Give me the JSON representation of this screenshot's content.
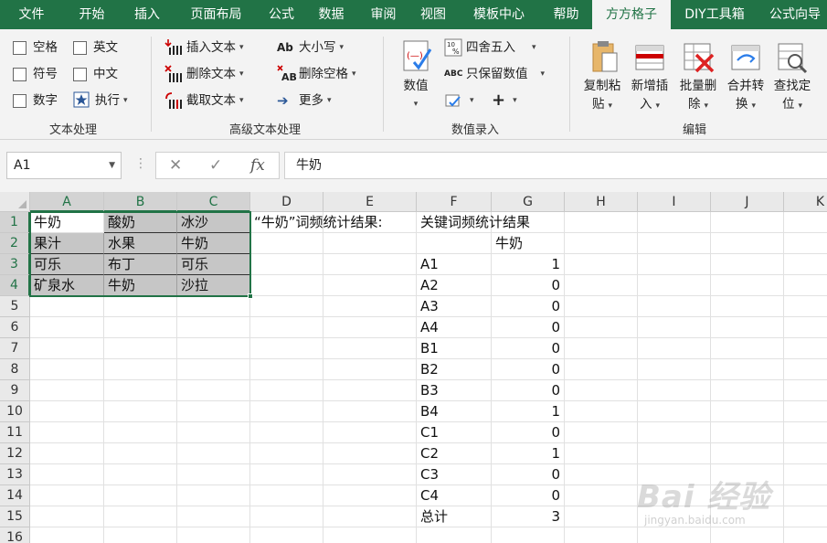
{
  "tabs": [
    {
      "label": "文件",
      "active": false
    },
    {
      "label": "开始",
      "active": false
    },
    {
      "label": "插入",
      "active": false
    },
    {
      "label": "页面布局",
      "active": false
    },
    {
      "label": "公式",
      "active": false
    },
    {
      "label": "数据",
      "active": false
    },
    {
      "label": "审阅",
      "active": false
    },
    {
      "label": "视图",
      "active": false
    },
    {
      "label": "模板中心",
      "active": false
    },
    {
      "label": "帮助",
      "active": false
    },
    {
      "label": "方方格子",
      "active": true
    },
    {
      "label": "DIY工具箱",
      "active": false
    },
    {
      "label": "公式向导",
      "active": false
    }
  ],
  "ribbon": {
    "text_group": {
      "label": "文本处理",
      "options": [
        "空格",
        "英文",
        "符号",
        "中文",
        "数字"
      ],
      "execute": "执行"
    },
    "adv_group": {
      "label": "高级文本处理",
      "insert": "插入文本",
      "delete": "删除文本",
      "extract": "截取文本",
      "case": "大小写",
      "remove_space": "删除空格",
      "more": "更多"
    },
    "num_group": {
      "label": "数值录入",
      "value": "数值",
      "round": "四舍五入",
      "keep_values": "只保留数值"
    },
    "edit_group": {
      "label": "编辑",
      "copy_paste": [
        "复制粘",
        "贴"
      ],
      "new_insert": [
        "新增插",
        "入"
      ],
      "batch_delete": [
        "批量删",
        "除"
      ],
      "merge": [
        "合并转",
        "换"
      ],
      "find": [
        "查找定",
        "位"
      ]
    }
  },
  "formula_bar": {
    "name_box": "A1",
    "formula": "牛奶"
  },
  "grid": {
    "columns": [
      "A",
      "B",
      "C",
      "D",
      "E",
      "F",
      "G",
      "H",
      "I",
      "J",
      "K"
    ],
    "selected_columns": [
      "A",
      "B",
      "C"
    ],
    "rows": [
      "1",
      "2",
      "3",
      "4",
      "5",
      "6",
      "7",
      "8",
      "9",
      "10",
      "11",
      "12",
      "13",
      "14",
      "15",
      "16"
    ],
    "selected_rows": [
      "1",
      "2",
      "3",
      "4"
    ],
    "data_block": [
      [
        "牛奶",
        "酸奶",
        "冰沙"
      ],
      [
        "果汁",
        "水果",
        "牛奶"
      ],
      [
        "可乐",
        "布丁",
        "可乐"
      ],
      [
        "矿泉水",
        "牛奶",
        "沙拉"
      ]
    ],
    "d1_text": "“牛奶”词频统计结果:",
    "f1_text": "关键词频统计结果",
    "g2_text": "牛奶",
    "results": [
      {
        "cell": "A1",
        "count": "1"
      },
      {
        "cell": "A2",
        "count": "0"
      },
      {
        "cell": "A3",
        "count": "0"
      },
      {
        "cell": "A4",
        "count": "0"
      },
      {
        "cell": "B1",
        "count": "0"
      },
      {
        "cell": "B2",
        "count": "0"
      },
      {
        "cell": "B3",
        "count": "0"
      },
      {
        "cell": "B4",
        "count": "1"
      },
      {
        "cell": "C1",
        "count": "0"
      },
      {
        "cell": "C2",
        "count": "1"
      },
      {
        "cell": "C3",
        "count": "0"
      },
      {
        "cell": "C4",
        "count": "0"
      },
      {
        "cell": "总计",
        "count": "3"
      }
    ]
  },
  "watermark": {
    "logo": "Bai 经验",
    "url": "jingyan.baidu.com"
  },
  "colors": {
    "brand": "#217346",
    "selection_fill": "#c6c6c6"
  }
}
